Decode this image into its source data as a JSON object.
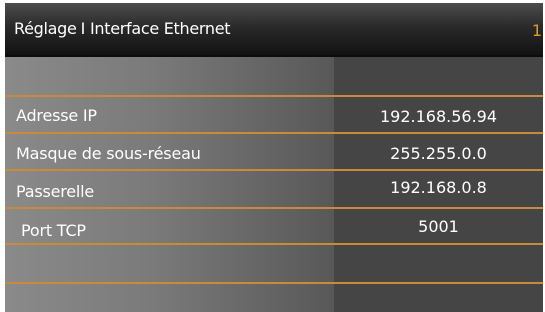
{
  "header": {
    "section": "Réglage",
    "separator": "I",
    "title": "Interface Ethernet",
    "page_number": "1"
  },
  "rows": [
    {
      "label": "",
      "value": ""
    },
    {
      "label": "Adresse IP",
      "value": "192.168.56.94"
    },
    {
      "label": "Masque de sous-réseau",
      "value": "255.255.0.0"
    },
    {
      "label": "Passerelle",
      "value": "192.168.0.8"
    },
    {
      "label": "Port TCP",
      "value": "5001"
    },
    {
      "label": "",
      "value": ""
    },
    {
      "label": "",
      "value": ""
    }
  ],
  "colors": {
    "accent": "#e8961e",
    "row_divider": "#c98a3a",
    "label_bg": "#7a7a7a",
    "value_bg": "#454545"
  }
}
